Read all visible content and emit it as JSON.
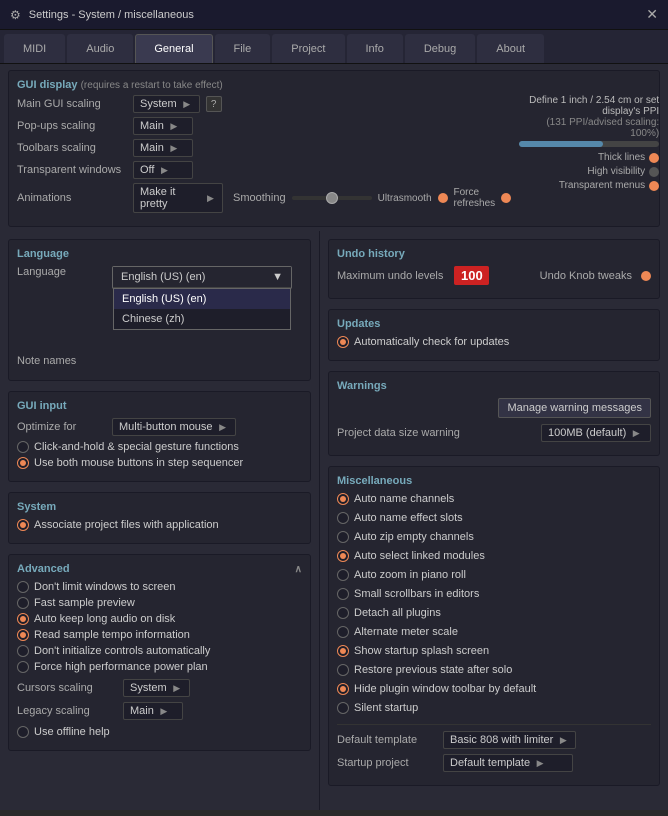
{
  "titleBar": {
    "icon": "⚙",
    "title": "Settings - System / miscellaneous",
    "closeBtn": "✕"
  },
  "tabs": [
    {
      "label": "MIDI",
      "active": false
    },
    {
      "label": "Audio",
      "active": false
    },
    {
      "label": "General",
      "active": true
    },
    {
      "label": "File",
      "active": false
    },
    {
      "label": "Project",
      "active": false
    },
    {
      "label": "Info",
      "active": false
    },
    {
      "label": "Debug",
      "active": false
    },
    {
      "label": "About",
      "active": false
    }
  ],
  "guiDisplay": {
    "sectionTitle": "GUI display",
    "sectionSubtitle": "(requires a restart to take effect)",
    "ppiLabel": "Define 1 inch / 2.54 cm or set display's PPI",
    "ppiNote": "(131 PPI/advised scaling: 100%)",
    "mainGuiScaling": {
      "label": "Main GUI scaling",
      "value": "System",
      "helpBtn": "?"
    },
    "popUpsScaling": {
      "label": "Pop-ups scaling",
      "value": "Main"
    },
    "toolbarsScaling": {
      "label": "Toolbars scaling",
      "value": "Main"
    },
    "transparentWindows": {
      "label": "Transparent windows",
      "value": "Off"
    },
    "animations": {
      "label": "Animations",
      "value": "Make it pretty"
    },
    "smoothingLabel": "Smoothing",
    "ultraSmoothLabel": "Ultrasmooth",
    "forceRefreshesLabel": "Force refreshes",
    "thickLinesLabel": "Thick lines",
    "highVisibilityLabel": "High visibility",
    "transparentMenusLabel": "Transparent menus"
  },
  "language": {
    "sectionTitle": "Language",
    "languageLabel": "Language",
    "selectedLanguage": "English (US) (en)",
    "options": [
      "English (US) (en)",
      "Chinese (zh)"
    ],
    "noteNamesLabel": "Note names",
    "noteNamesValue": ""
  },
  "guiInput": {
    "sectionTitle": "GUI input",
    "optimizeForLabel": "Optimize for",
    "optimizeForValue": "Multi-button mouse",
    "clickAndHoldLabel": "Click-and-hold & special gesture functions",
    "bothMouseBtnsLabel": "Use both mouse buttons in step sequencer",
    "bothMouseActive": true
  },
  "system": {
    "sectionTitle": "System",
    "associateLabel": "Associate project files with application",
    "associateActive": true
  },
  "advanced": {
    "sectionTitle": "Advanced",
    "items": [
      {
        "label": "Don't limit windows to screen",
        "active": false
      },
      {
        "label": "Fast sample preview",
        "active": false
      },
      {
        "label": "Auto keep long audio on disk",
        "active": true
      },
      {
        "label": "Read sample tempo information",
        "active": true
      },
      {
        "label": "Don't initialize controls automatically",
        "active": false
      },
      {
        "label": "Force high performance power plan",
        "active": false
      }
    ],
    "cursorsScaling": {
      "label": "Cursors scaling",
      "value": "System"
    },
    "legacyScaling": {
      "label": "Legacy scaling",
      "value": "Main"
    },
    "useOfflineHelp": {
      "label": "Use offline help",
      "active": false
    }
  },
  "undoHistory": {
    "sectionTitle": "Undo history",
    "maxUndoLevelsLabel": "Maximum undo levels",
    "maxUndoLevelsValue": "100",
    "undoKnobTweaksLabel": "Undo Knob tweaks"
  },
  "updates": {
    "sectionTitle": "Updates",
    "autoCheckLabel": "Automatically check for updates",
    "autoCheckActive": true
  },
  "warnings": {
    "sectionTitle": "Warnings",
    "manageWarningsBtn": "Manage warning messages",
    "projectDataSizeLabel": "Project data size warning",
    "projectDataSizeValue": "100MB (default)"
  },
  "miscellaneous": {
    "sectionTitle": "Miscellaneous",
    "items": [
      {
        "label": "Auto name channels",
        "active": true
      },
      {
        "label": "Auto name effect slots",
        "active": false
      },
      {
        "label": "Auto zip empty channels",
        "active": false
      },
      {
        "label": "Auto select linked modules",
        "active": true
      },
      {
        "label": "Auto zoom in piano roll",
        "active": false
      },
      {
        "label": "Small scrollbars in editors",
        "active": false
      },
      {
        "label": "Detach all plugins",
        "active": false
      },
      {
        "label": "Alternate meter scale",
        "active": false
      },
      {
        "label": "Show startup splash screen",
        "active": true
      },
      {
        "label": "Restore previous state after solo",
        "active": false
      },
      {
        "label": "Hide plugin window toolbar by default",
        "active": true
      },
      {
        "label": "Silent startup",
        "active": false
      }
    ],
    "defaultTemplateLabel": "Default template",
    "defaultTemplateValue": "Basic 808 with limiter",
    "startupProjectLabel": "Startup project",
    "startupProjectValue": "Default template"
  }
}
